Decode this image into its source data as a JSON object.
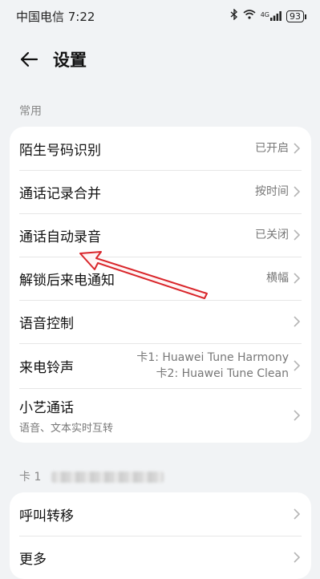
{
  "status": {
    "carrier_time": "中国电信 7:22",
    "signal_text": "4G",
    "battery": "93"
  },
  "header": {
    "title": "设置"
  },
  "sections": {
    "common_label": "常用",
    "card1_label": "卡 1"
  },
  "settings": [
    {
      "label": "陌生号码识别",
      "value": "已开启"
    },
    {
      "label": "通话记录合并",
      "value": "按时间"
    },
    {
      "label": "通话自动录音",
      "value": "已关闭"
    },
    {
      "label": "解锁后来电通知",
      "value": "横幅"
    },
    {
      "label": "语音控制",
      "value": ""
    },
    {
      "label": "来电铃声",
      "value_line1": "卡1: Huawei Tune Harmony",
      "value_line2": "卡2: Huawei Tune Clean"
    },
    {
      "label": "小艺通话",
      "subtitle": "语音、文本实时互转"
    }
  ],
  "card1_settings": [
    {
      "label": "呼叫转移"
    },
    {
      "label": "更多"
    }
  ],
  "colors": {
    "annotation_arrow": "#d9262b"
  }
}
